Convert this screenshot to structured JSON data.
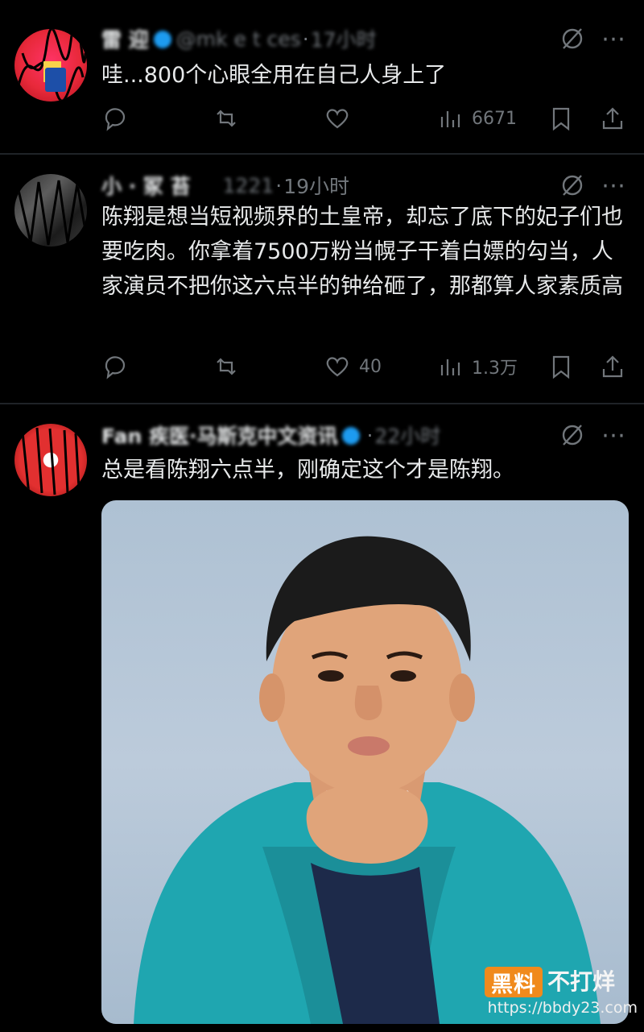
{
  "posts": [
    {
      "author_name": "雷 迎",
      "handle": "@mk e t ces",
      "time": "17小时",
      "text": "哇...800个心眼全用在自己人身上了",
      "replies": "",
      "reposts": "",
      "likes": "",
      "views": "6671"
    },
    {
      "author_name": "小 ·  冢 苔",
      "handle": "1221",
      "time": "19小时",
      "text": "陈翔是想当短视频界的土皇帝，却忘了底下的妃子们也要吃肉。你拿着7500万粉当幌子干着白嫖的勾当，人家演员不把你这六点半的钟给砸了，那都算人家素质高",
      "replies": "",
      "reposts": "",
      "likes": "40",
      "views": "1.3万"
    },
    {
      "author_name": "Fan 疾医·马斯克中文资讯",
      "handle": "",
      "time": "22小时",
      "text": "总是看陈翔六点半，刚确定这个才是陈翔。",
      "has_image": true
    }
  ],
  "icons": {
    "reply": "speech-bubble-icon",
    "repost": "repost-arrows-icon",
    "like": "heart-icon",
    "views": "bar-chart-icon",
    "bookmark": "bookmark-icon",
    "share": "share-upload-icon",
    "grok": "slashed-circle-icon",
    "more": "more-dots-icon"
  },
  "watermark": {
    "badge": "黑料",
    "text": "不打烊",
    "url": "https://bbdy23.com"
  },
  "colors": {
    "background": "#000000",
    "text": "#e7e9ea",
    "muted": "#71767b",
    "verified": "#1d9bf0",
    "watermark_badge": "#f08a1c"
  }
}
